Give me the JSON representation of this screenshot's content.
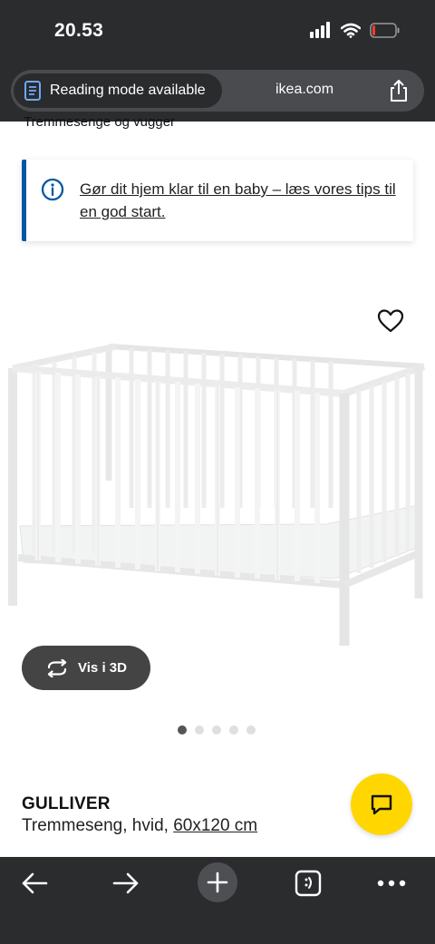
{
  "status_bar": {
    "time": "20.53"
  },
  "browser": {
    "reading_mode_label": "Reading mode available",
    "domain": "ikea.com"
  },
  "breadcrumb": "Tremmesenge og vugger",
  "info_banner": {
    "text": "Gør dit hjem klar til en baby – læs vores tips til en god start.",
    "accent_color": "#0058a3"
  },
  "product": {
    "name": "GULLIVER",
    "desc_prefix": "Tremmeseng, hvid, ",
    "size": "60x120 cm",
    "image_pages": 5,
    "active_page": 1
  },
  "buttons": {
    "view_3d": "Vis i 3D"
  },
  "colors": {
    "chat_button": "#ffd600",
    "chrome": "#2b2c2e"
  },
  "icons": [
    "signal-icon",
    "wifi-icon",
    "battery-icon",
    "reading-mode-icon",
    "share-icon",
    "info-icon",
    "heart-icon",
    "rotate-3d-icon",
    "chat-icon",
    "back-arrow-icon",
    "forward-arrow-icon",
    "plus-icon",
    "tabs-icon",
    "more-icon"
  ]
}
